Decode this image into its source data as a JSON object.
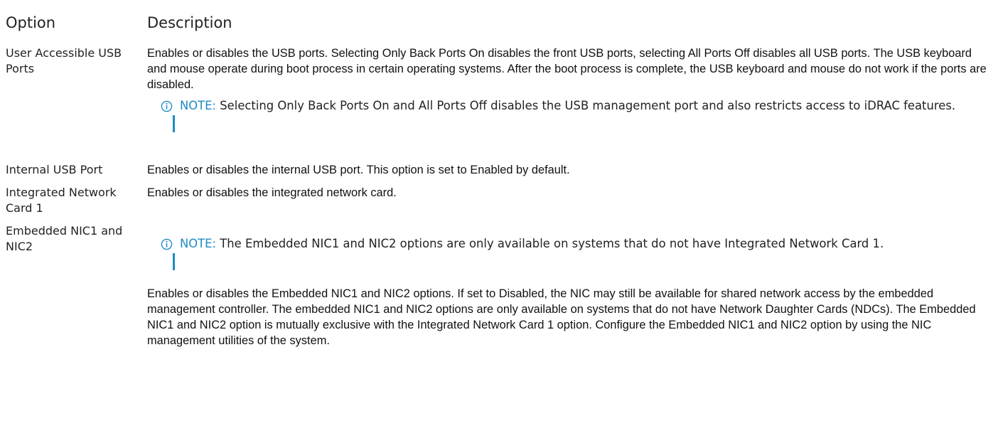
{
  "header": {
    "option": "Option",
    "description": "Description"
  },
  "rows": [
    {
      "option": "User Accessible USB Ports",
      "description": "Enables or disables the USB ports. Selecting Only Back Ports On disables the front USB ports, selecting All Ports Off disables all USB ports. The USB keyboard and mouse operate during boot process in certain operating systems. After the boot process is complete, the USB keyboard and mouse do not work if the ports are disabled.",
      "note_label": "NOTE:",
      "note_text": " Selecting Only Back Ports On and All Ports Off disables the USB management port and also restricts access to iDRAC features."
    },
    {
      "option": "Internal USB Port",
      "description": "Enables or disables the internal USB port. This option is set to Enabled by default."
    },
    {
      "option": "Integrated Network Card 1",
      "description": "Enables or disables the integrated network card."
    },
    {
      "option": "Embedded NIC1 and NIC2",
      "note_label": "NOTE:",
      "note_text": " The Embedded NIC1 and NIC2 options are only available on systems that do not have Integrated Network Card 1.",
      "description": "Enables or disables the Embedded NIC1 and NIC2 options. If set to Disabled, the NIC may still be available for shared network access by the embedded management controller. The embedded NIC1 and NIC2 options are only available on systems that do not have Network Daughter Cards (NDCs). The Embedded NIC1 and NIC2 option is mutually exclusive with the Integrated Network Card 1 option. Configure the Embedded NIC1 and NIC2 option by using the NIC management utilities of the system."
    }
  ],
  "colors": {
    "note_accent": "#1d8bc2"
  },
  "icons": {
    "note": "info-icon"
  }
}
